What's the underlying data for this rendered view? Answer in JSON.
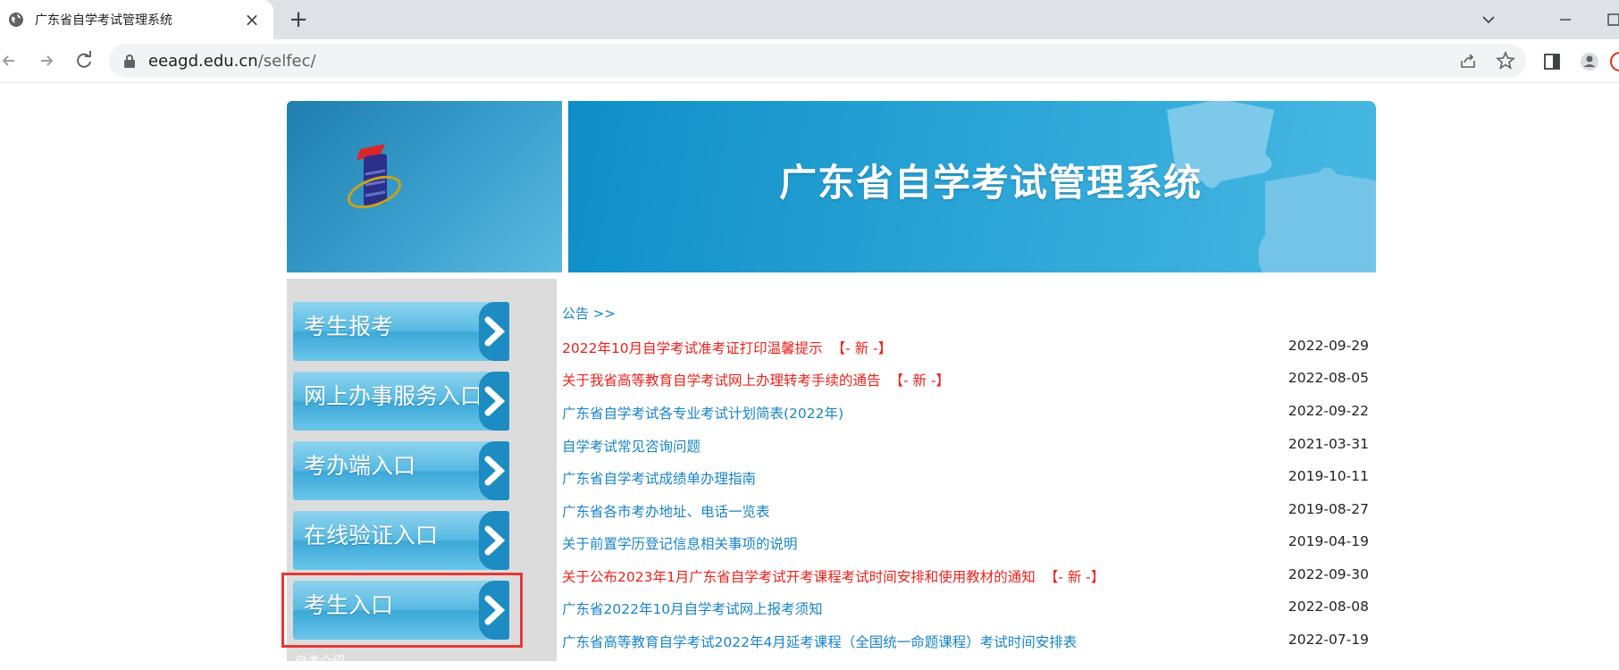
{
  "browser": {
    "tab_title": "广东省自学考试管理系统",
    "url_host": "eeagd.edu.cn",
    "url_path": "/selfec/",
    "new_tab_glyph": "+",
    "close_glyph": "×"
  },
  "header": {
    "title": "广东省自学考试管理系统"
  },
  "sidebar": {
    "items": [
      {
        "label": "考生报考"
      },
      {
        "label": "网上办事服务入口"
      },
      {
        "label": "考办端入口"
      },
      {
        "label": "在线验证入口"
      },
      {
        "label": "考生入口"
      }
    ],
    "more_label": "自考介绍"
  },
  "notices": {
    "header": "公告 >>",
    "new_tag": "【- 新 -】",
    "items": [
      {
        "title": "2022年10月自学考试准考证打印温馨提示",
        "date": "2022-09-29",
        "is_new": true
      },
      {
        "title": "关于我省高等教育自学考试网上办理转考手续的通告",
        "date": "2022-08-05",
        "is_new": true
      },
      {
        "title": "广东省自学考试各专业考试计划简表(2022年)",
        "date": "2022-09-22",
        "is_new": false
      },
      {
        "title": "自学考试常见咨询问题",
        "date": "2021-03-31",
        "is_new": false
      },
      {
        "title": "广东省自学考试成绩单办理指南",
        "date": "2019-10-11",
        "is_new": false
      },
      {
        "title": "广东省各市考办地址、电话一览表",
        "date": "2019-08-27",
        "is_new": false
      },
      {
        "title": "关于前置学历登记信息相关事项的说明",
        "date": "2019-04-19",
        "is_new": false
      },
      {
        "title": "关于公布2023年1月广东省自学考试开考课程考试时间安排和使用教材的通知",
        "date": "2022-09-30",
        "is_new": true
      },
      {
        "title": "广东省2022年10月自学考试网上报考须知",
        "date": "2022-08-08",
        "is_new": false
      },
      {
        "title": "广东省高等教育自学考试2022年4月延考课程（全国统一命题课程）考试时间安排表",
        "date": "2022-07-19",
        "is_new": false
      }
    ]
  },
  "colors": {
    "link_blue": "#1a84c6",
    "new_red": "#e8231c",
    "highlight": "#e53935"
  },
  "icons": [
    "globe-icon",
    "close-icon",
    "plus-icon",
    "chevron-down-icon",
    "minimize-icon",
    "maximize-icon",
    "back-icon",
    "forward-icon",
    "reload-icon",
    "lock-icon",
    "share-icon",
    "star-icon",
    "sidepanel-icon",
    "profile-icon",
    "logo-icon",
    "arrow-right-icon"
  ]
}
